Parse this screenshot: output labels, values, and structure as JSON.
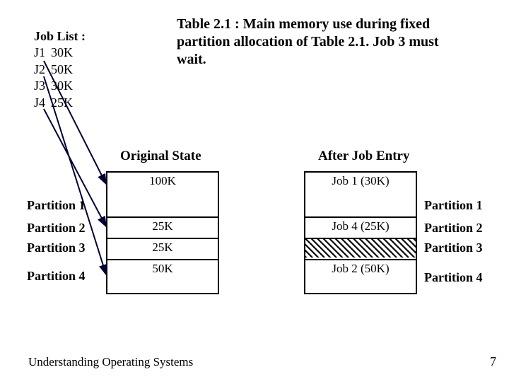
{
  "joblist": {
    "header": "Job List :",
    "rows": [
      {
        "name": "J1",
        "size": "30K"
      },
      {
        "name": "J2",
        "size": "50K"
      },
      {
        "name": "J3",
        "size": "30K"
      },
      {
        "name": "J4",
        "size": "25K"
      }
    ]
  },
  "caption": "Table 2.1 : Main memory use during fixed partition allocation of Table 2.1. Job 3 must wait.",
  "columns": {
    "original": "Original State",
    "after": "After Job Entry"
  },
  "original": {
    "p1": "100K",
    "p2": "25K",
    "p3": "25K",
    "p4": "50K"
  },
  "after": {
    "p1": "Job 1 (30K)",
    "p2": "Job 4 (25K)",
    "p3": "",
    "p4": "Job 2 (50K)"
  },
  "labels": {
    "p1": "Partition 1",
    "p2": "Partition 2",
    "p3": "Partition 3",
    "p4": "Partition 4"
  },
  "footer": "Understanding Operating Systems",
  "page": "7",
  "chart_data": {
    "type": "table",
    "title": "Table 2.1 : Main memory use during fixed partition allocation of Table 2.1. Job 3 must wait.",
    "partitions": [
      {
        "name": "Partition 1",
        "size_k": 100,
        "original": "100K",
        "after_job_entry": "Job 1 (30K)"
      },
      {
        "name": "Partition 2",
        "size_k": 25,
        "original": "25K",
        "after_job_entry": "Job 4 (25K)"
      },
      {
        "name": "Partition 3",
        "size_k": 25,
        "original": "25K",
        "after_job_entry": "(hatched / unused — Job 3 waits)"
      },
      {
        "name": "Partition 4",
        "size_k": 50,
        "original": "50K",
        "after_job_entry": "Job 2 (50K)"
      }
    ],
    "jobs": [
      {
        "name": "J1",
        "size_k": 30,
        "assigned_partition": "Partition 1"
      },
      {
        "name": "J2",
        "size_k": 50,
        "assigned_partition": "Partition 4"
      },
      {
        "name": "J3",
        "size_k": 30,
        "assigned_partition": null
      },
      {
        "name": "J4",
        "size_k": 25,
        "assigned_partition": "Partition 2"
      }
    ]
  }
}
